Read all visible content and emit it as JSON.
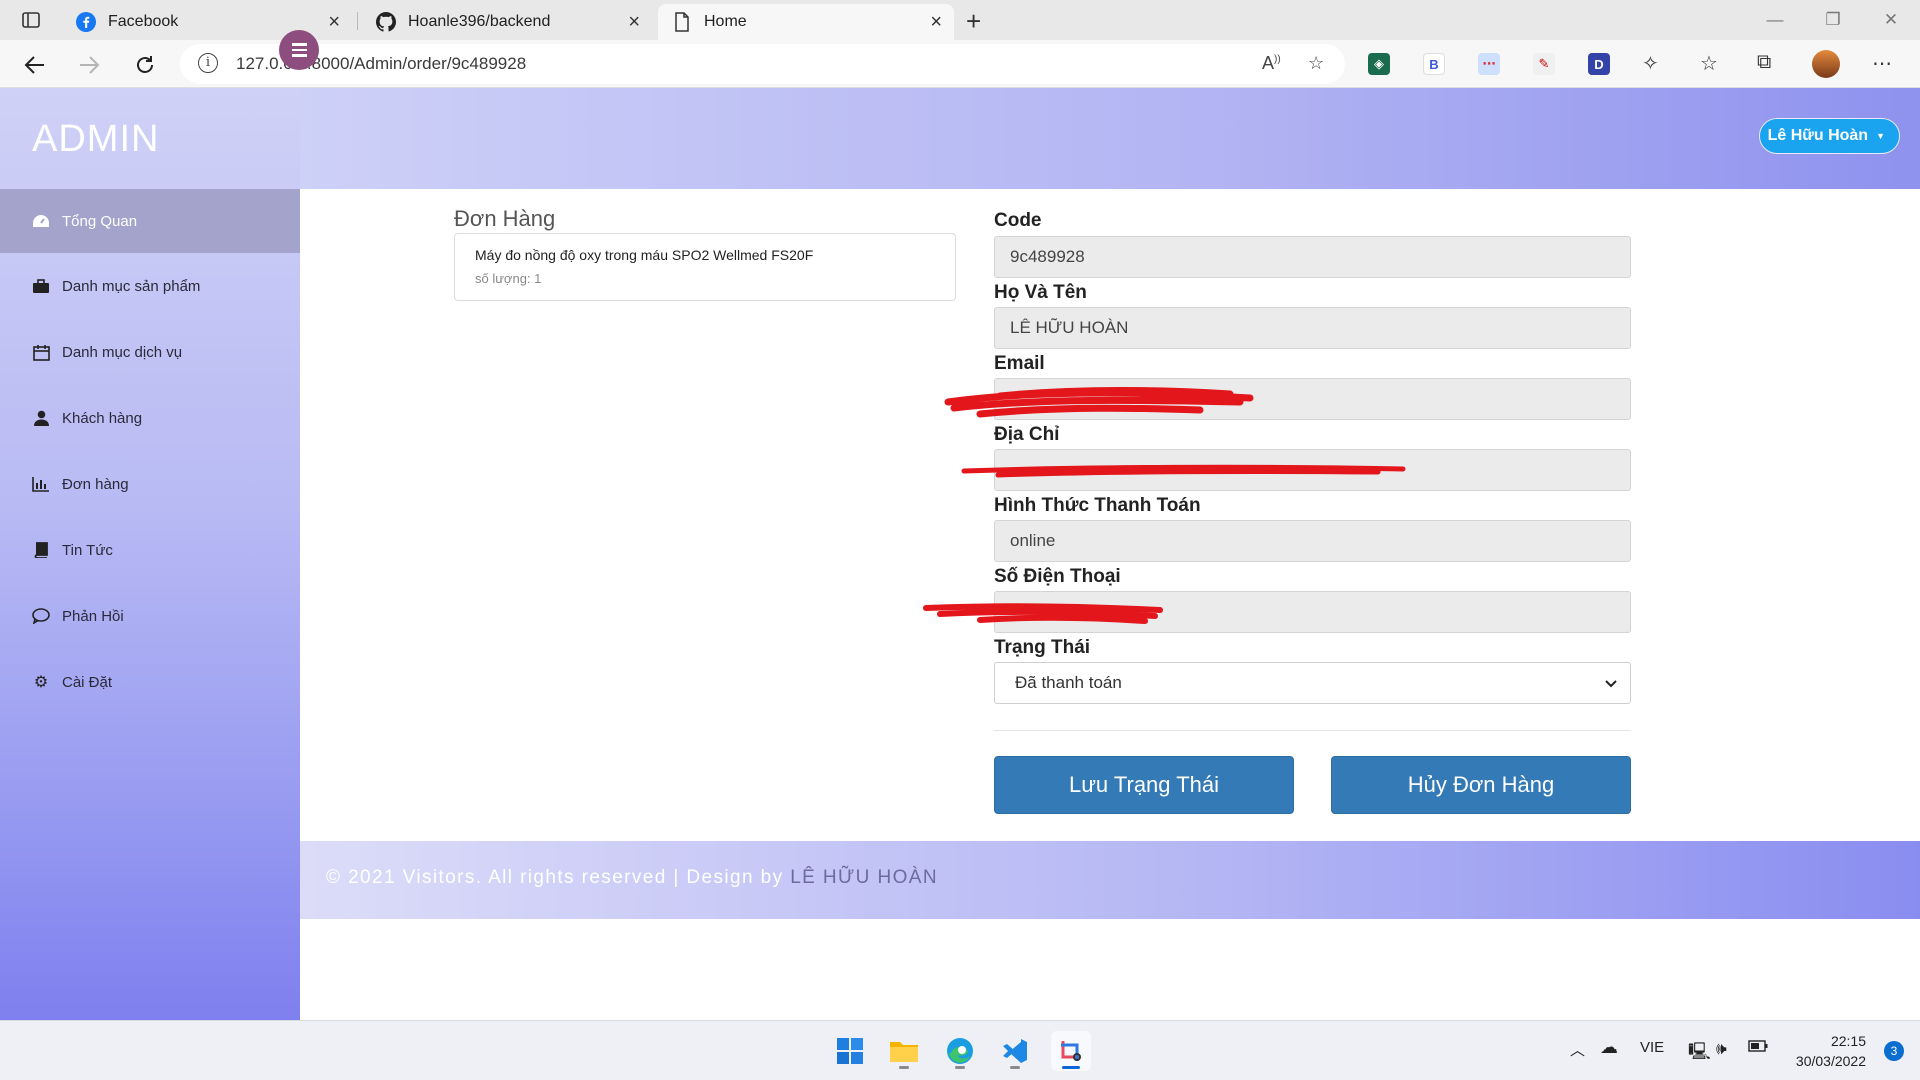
{
  "browser": {
    "tabs": [
      {
        "title": "Facebook",
        "icon": "facebook-icon",
        "active": false
      },
      {
        "title": "Hoanle396/backend",
        "icon": "github-icon",
        "active": false
      },
      {
        "title": "Home",
        "icon": "page-icon",
        "active": true
      }
    ],
    "url": "127.0.0.1:8000/Admin/order/9c489928"
  },
  "sidebar": {
    "brand": "ADMIN",
    "items": [
      {
        "label": "Tổng Quan",
        "icon": "dashboard-icon"
      },
      {
        "label": "Danh mục sản phẩm",
        "icon": "briefcase-icon"
      },
      {
        "label": "Danh mục dịch vụ",
        "icon": "calendar-icon"
      },
      {
        "label": "Khách hàng",
        "icon": "user-icon"
      },
      {
        "label": "Đơn hàng",
        "icon": "bar-chart-icon"
      },
      {
        "label": "Tin Tức",
        "icon": "book-icon"
      },
      {
        "label": "Phản Hồi",
        "icon": "comment-icon"
      },
      {
        "label": "Cài Đặt",
        "icon": "gear-icon"
      }
    ]
  },
  "header": {
    "user_name": "Lê Hữu Hoàn"
  },
  "orders": {
    "title": "Đơn Hàng",
    "items": [
      {
        "name": "Máy đo nồng độ oxy trong máu SPO2 Wellmed FS20F",
        "quantity": "số lượng: 1"
      }
    ]
  },
  "form": {
    "code_label": "Code",
    "code_value": "9c489928",
    "name_label": "Họ Và Tên",
    "name_value": "LÊ HỮU HOÀN",
    "email_label": "Email",
    "email_value": "",
    "address_label": "Địa Chỉ",
    "address_value": "",
    "payment_label": "Hình Thức Thanh Toán",
    "payment_value": "online",
    "phone_label": "Số Điện Thoại",
    "phone_value": "",
    "status_label": "Trạng Thái",
    "status_value": "Đã thanh toán",
    "save_button": "Lưu Trạng Thái",
    "cancel_button": "Hủy Đơn Hàng"
  },
  "footer": {
    "text": "© 2021 Visitors. All rights reserved | Design by ",
    "author": "LÊ HỮU HOÀN"
  },
  "taskbar": {
    "language": "VIE",
    "time": "22:15",
    "date": "30/03/2022",
    "notifications": "3"
  },
  "colors": {
    "accent_button": "#337ab7",
    "user_button": "#1aa3ee",
    "toggle": "#8d4e7f",
    "redaction": "#e3161b"
  }
}
